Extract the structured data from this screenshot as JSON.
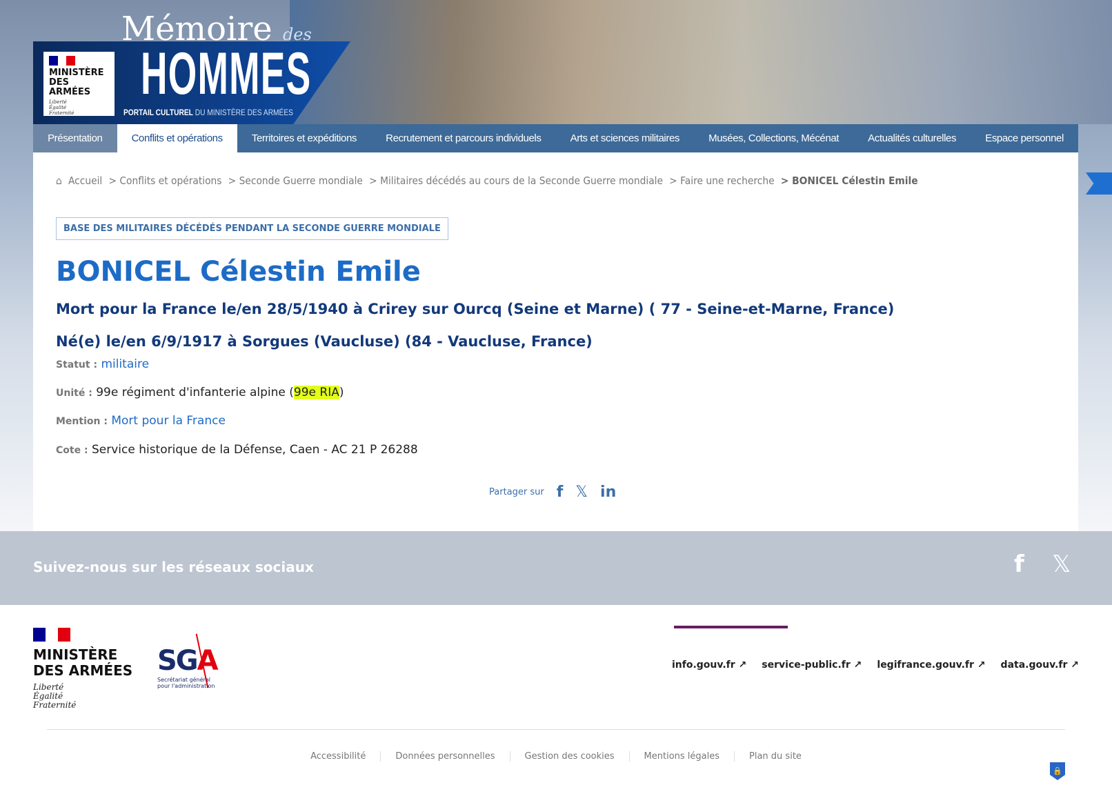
{
  "header": {
    "title_top": "Mémoire",
    "title_des": "des",
    "title_main": "HOMMES",
    "subtitle_bold": "PORTAIL CULTUREL",
    "subtitle_rest": " DU MINISTÈRE DES ARMÉES",
    "ministry": "MINISTÈRE DES ARMÉES",
    "motto": [
      "Liberté",
      "Égalité",
      "Fraternité"
    ]
  },
  "nav": [
    "Présentation",
    "Conflits et opérations",
    "Territoires et expéditions",
    "Recrutement et parcours individuels",
    "Arts et sciences militaires",
    "Musées, Collections, Mécénat",
    "Actualités culturelles",
    "Espace personnel"
  ],
  "breadcrumb": [
    "Accueil",
    "> Conflits et opérations",
    "> Seconde Guerre mondiale",
    "> Militaires décédés au cours de la Seconde Guerre mondiale",
    "> Faire une recherche",
    "> BONICEL Célestin Emile"
  ],
  "badge": "BASE DES MILITAIRES DÉCÉDÉS PENDANT LA SECONDE GUERRE MONDIALE",
  "record": {
    "name": "BONICEL Célestin Emile",
    "death": "Mort pour la France le/en 28/5/1940 à Crirey sur Ourcq (Seine et Marne) ( 77 - Seine-et-Marne, France)",
    "birth": "Né(e) le/en 6/9/1917 à Sorgues (Vaucluse) (84 - Vaucluse, France)",
    "statut_label": "Statut :",
    "statut": "militaire",
    "unite_label": "Unité :",
    "unite": "99e régiment d'infanterie alpine (",
    "unite_abbr": "99e RIA",
    "unite_end": ")",
    "mention_label": "Mention :",
    "mention": "Mort pour la France",
    "cote_label": "Cote :",
    "cote": "Service historique de la Défense, Caen - AC 21 P 26288"
  },
  "share": {
    "label": "Partager sur"
  },
  "social": {
    "title": "Suivez-nous sur les réseaux sociaux"
  },
  "footer": {
    "ministry_l1": "MINISTÈRE",
    "ministry_l2": "DES ARMÉES",
    "motto": [
      "Liberté",
      "Égalité",
      "Fraternité"
    ],
    "sga": "SG",
    "sga_a": "A",
    "sga_sub1": "Secrétariat général",
    "sga_sub2": "pour l'administration",
    "links": [
      "info.gouv.fr",
      "service-public.fr",
      "legifrance.gouv.fr",
      "data.gouv.fr"
    ],
    "bottom": [
      "Accessibilité",
      "Données personnelles",
      "Gestion des cookies",
      "Mentions légales",
      "Plan du site"
    ]
  },
  "colors": {
    "accent": "#1d6bc6",
    "nav": "#3d6a98",
    "highlight": "#e3ff1a"
  }
}
